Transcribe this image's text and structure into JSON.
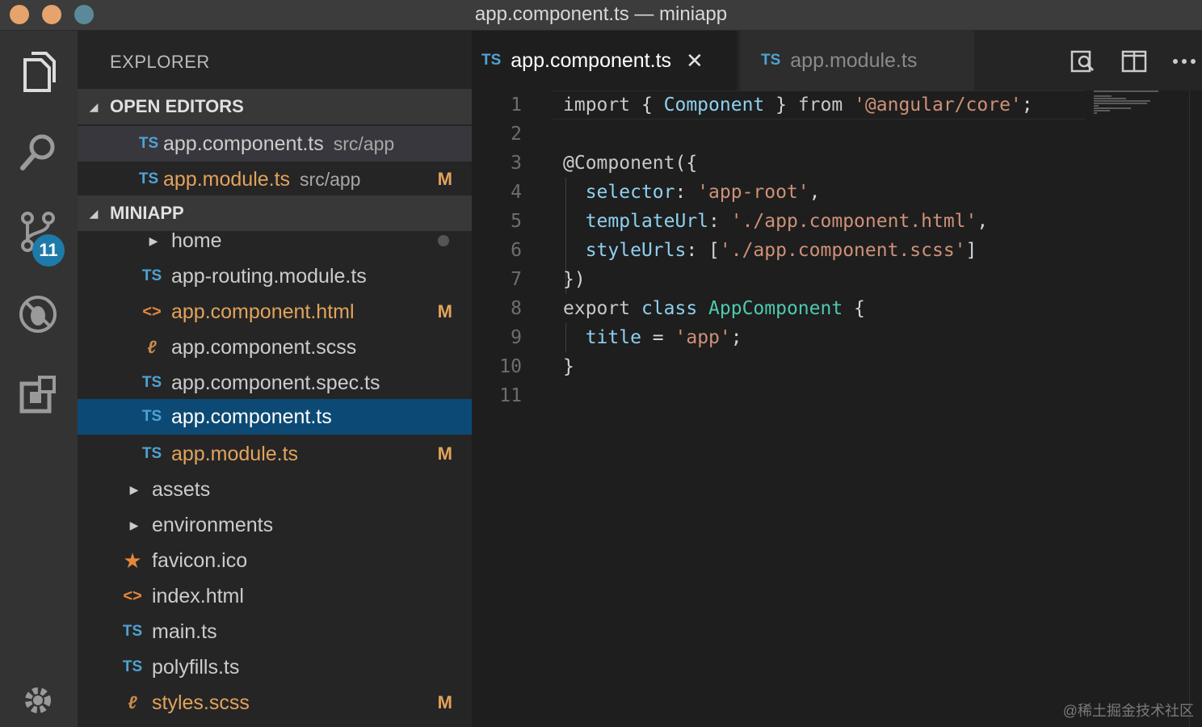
{
  "window": {
    "title": "app.component.ts — miniapp"
  },
  "activity_bar": {
    "source_control_badge": "11"
  },
  "sidebar": {
    "title": "EXPLORER",
    "open_editors": {
      "header": "OPEN EDITORS",
      "items": [
        {
          "icon": "TS",
          "name": "app.component.ts",
          "path": "src/app",
          "modified": ""
        },
        {
          "icon": "TS",
          "name": "app.module.ts",
          "path": "src/app",
          "modified": "M"
        }
      ]
    },
    "project": {
      "header": "MINIAPP",
      "items": [
        {
          "icon": "",
          "name": "home",
          "modified": ""
        },
        {
          "icon": "TS",
          "name": "app-routing.module.ts",
          "modified": ""
        },
        {
          "icon": "<>",
          "name": "app.component.html",
          "modified": "M"
        },
        {
          "icon": "scss",
          "name": "app.component.scss",
          "modified": ""
        },
        {
          "icon": "TS",
          "name": "app.component.spec.ts",
          "modified": ""
        },
        {
          "icon": "TS",
          "name": "app.component.ts",
          "modified": ""
        },
        {
          "icon": "TS",
          "name": "app.module.ts",
          "modified": "M"
        },
        {
          "icon": "",
          "name": "assets",
          "modified": ""
        },
        {
          "icon": "",
          "name": "environments",
          "modified": ""
        },
        {
          "icon": "★",
          "name": "favicon.ico",
          "modified": ""
        },
        {
          "icon": "<>",
          "name": "index.html",
          "modified": ""
        },
        {
          "icon": "TS",
          "name": "main.ts",
          "modified": ""
        },
        {
          "icon": "TS",
          "name": "polyfills.ts",
          "modified": ""
        },
        {
          "icon": "scss",
          "name": "styles.scss",
          "modified": "M"
        }
      ]
    }
  },
  "tabs": [
    {
      "icon": "TS",
      "label": "app.component.ts",
      "active": true,
      "close": "✕"
    },
    {
      "icon": "TS",
      "label": "app.module.ts",
      "active": false
    }
  ],
  "editor": {
    "line_numbers": [
      "1",
      "2",
      "3",
      "4",
      "5",
      "6",
      "7",
      "8",
      "9",
      "10",
      "11"
    ]
  },
  "watermark": "@稀土掘金技术社区",
  "colors": {
    "selection": "#0c4a75",
    "modified": "#e2a35a",
    "ts_icon": "#4fa3d4",
    "badge": "#1e7aa8"
  }
}
